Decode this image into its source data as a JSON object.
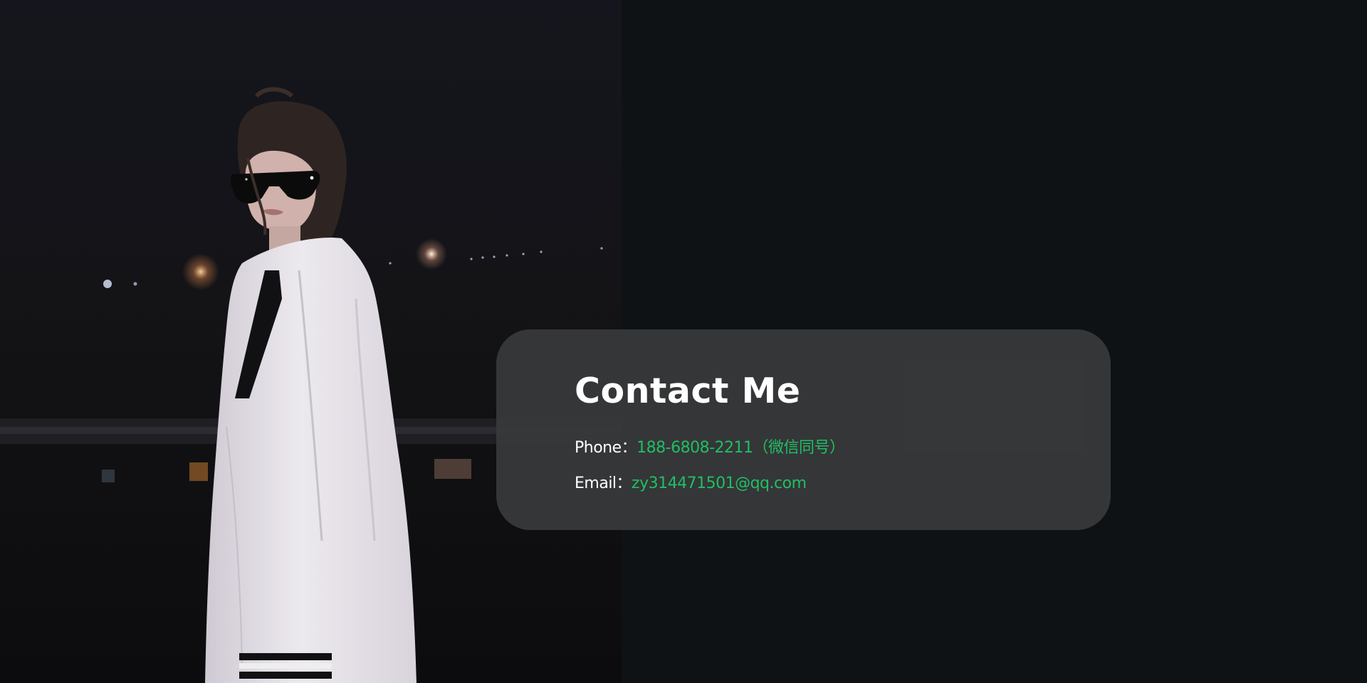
{
  "contact": {
    "title": "Contact Me",
    "phone_label": "Phone：",
    "phone_value": "188-6808-2211（微信同号）",
    "email_label": "Email：",
    "email_value": "zy314471501@qq.com"
  },
  "photo": {
    "icon": "portrait-photo",
    "description_colors": {
      "sky": "#15161d",
      "shirt": "#e9e6ec",
      "accent": "#1fbf63"
    }
  }
}
